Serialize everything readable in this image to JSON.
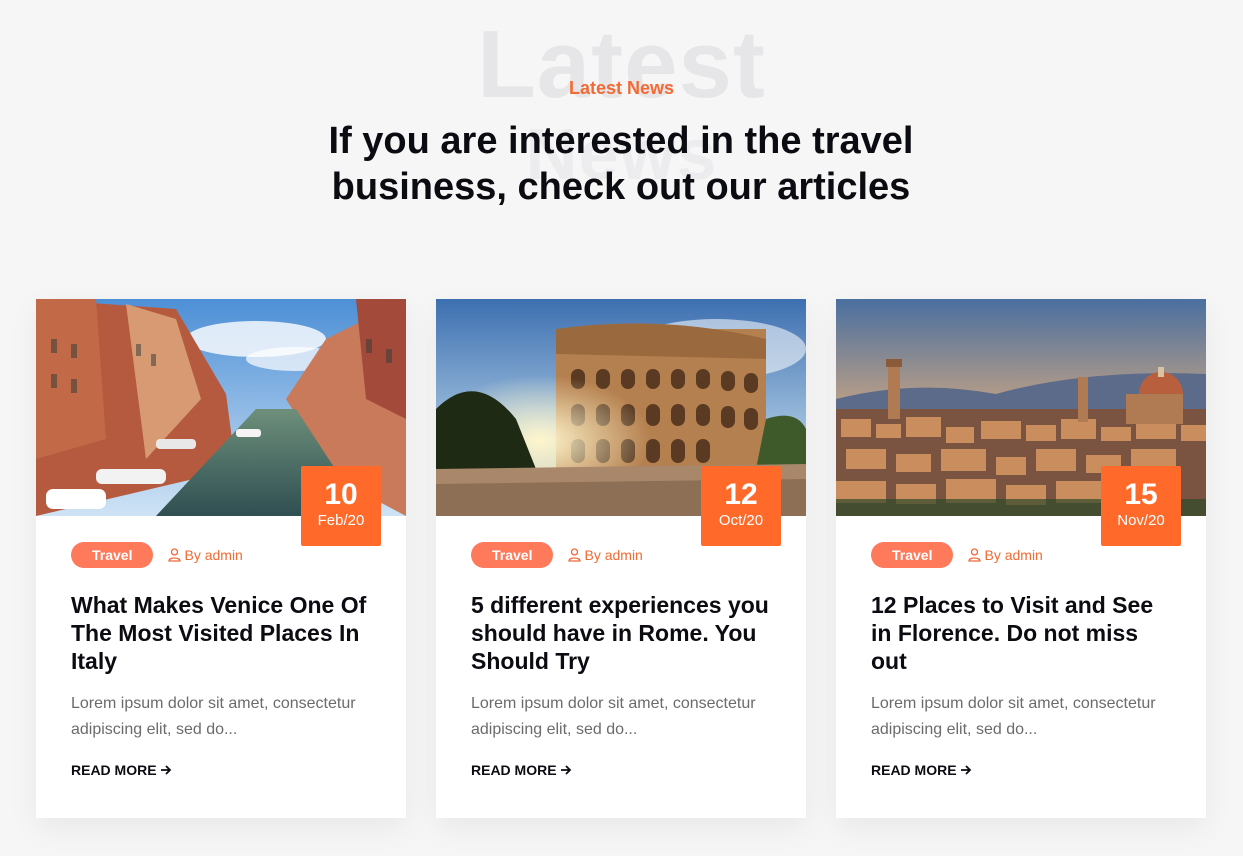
{
  "header": {
    "ghost_line_1": "Latest",
    "ghost_line_2": "News",
    "eyebrow": "Latest News",
    "headline": "If you are interested in the travel business, check out our articles"
  },
  "posts": [
    {
      "image": "venice-canal",
      "day": "10",
      "month": "Feb/20",
      "tag": "Travel",
      "author": "By admin",
      "title": "What Makes Venice One Of The Most Visited Places In Italy",
      "excerpt": "Lorem ipsum dolor sit amet, consectetur adipiscing elit, sed do...",
      "read_more": "READ MORE"
    },
    {
      "image": "rome-colosseum",
      "day": "12",
      "month": "Oct/20",
      "tag": "Travel",
      "author": "By admin",
      "title": "5 different experiences you should have in Rome. You Should Try",
      "excerpt": "Lorem ipsum dolor sit amet, consectetur adipiscing elit, sed do...",
      "read_more": "READ MORE"
    },
    {
      "image": "florence-skyline",
      "day": "15",
      "month": "Nov/20",
      "tag": "Travel",
      "author": "By admin",
      "title": "12 Places to Visit and See in Florence. Do not miss out",
      "excerpt": "Lorem ipsum dolor sit amet, consectetur adipiscing elit, sed do...",
      "read_more": "READ MORE"
    }
  ],
  "colors": {
    "accent": "#ff6a2b",
    "tag": "#ff7a5a",
    "background": "#f6f6f6",
    "heading": "#0b0b12",
    "body_text": "#6b6b6b"
  }
}
